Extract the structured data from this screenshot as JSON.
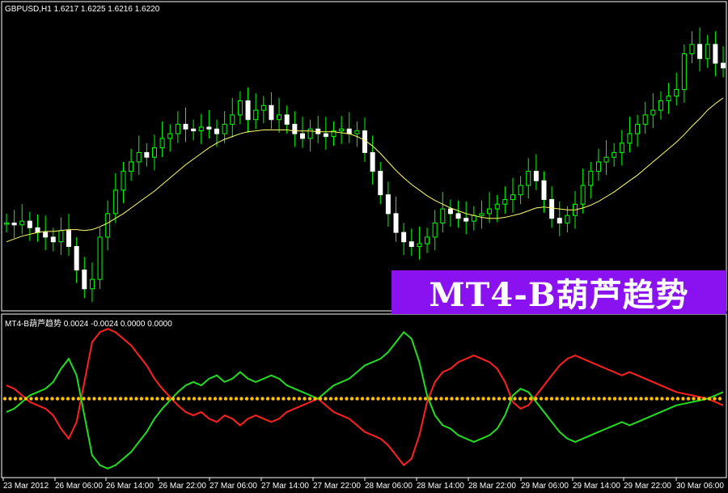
{
  "main_panel": {
    "symbol_info": "GBPUSD,H1  1.6217 1.6225 1.6216 1.6220",
    "colors": {
      "bull": "#00ff00",
      "bear": "#ffffff",
      "wick": "#00ff00",
      "ma": "#ffff66"
    }
  },
  "indicator_panel": {
    "info": "MT4-B葫芦趋势 0.0024 -0.0024 0.0000 0.0000",
    "colors": {
      "up": "#ff2020",
      "down": "#20dd20",
      "zero": "#ffc000"
    }
  },
  "watermark": {
    "text": "MT4-B葫芦趋势",
    "bg": "#8a12f0"
  },
  "time_axis": [
    "23 Mar 2012",
    "26 Mar 06:00",
    "26 Mar 14:00",
    "26 Mar 22:00",
    "27 Mar 06:00",
    "27 Mar 14:00",
    "27 Mar 22:00",
    "28 Mar 06:00",
    "28 Mar 14:00",
    "28 Mar 22:00",
    "29 Mar 06:00",
    "29 Mar 14:00",
    "29 Mar 22:00",
    "30 Mar 06:00"
  ],
  "chart_data": {
    "type": "line",
    "price_series": {
      "close": [
        1.587,
        1.5868,
        1.5872,
        1.5865,
        1.586,
        1.5855,
        1.585,
        1.5862,
        1.5845,
        1.582,
        1.58,
        1.581,
        1.5855,
        1.588,
        1.5905,
        1.5925,
        1.5935,
        1.5945,
        1.594,
        1.595,
        1.596,
        1.5965,
        1.5975,
        1.597,
        1.5968,
        1.5972,
        1.597,
        1.5965,
        1.5975,
        1.5985,
        1.6,
        1.598,
        1.599,
        1.5995,
        1.598,
        1.5985,
        1.5975,
        1.5965,
        1.596,
        1.597,
        1.5965,
        1.5962,
        1.5968,
        1.597,
        1.5965,
        1.5968,
        1.5945,
        1.5925,
        1.59,
        1.588,
        1.586,
        1.585,
        1.5845,
        1.5848,
        1.5855,
        1.587,
        1.5885,
        1.588,
        1.5875,
        1.5872,
        1.5878,
        1.588,
        1.5885,
        1.589,
        1.5895,
        1.59,
        1.591,
        1.5925,
        1.5915,
        1.5895,
        1.5875,
        1.587,
        1.5878,
        1.589,
        1.591,
        1.5925,
        1.5935,
        1.594,
        1.5945,
        1.5955,
        1.5965,
        1.5975,
        1.5985,
        1.599,
        1.6,
        1.6005,
        1.6012,
        1.605,
        1.606,
        1.6045,
        1.606,
        1.604,
        1.6035
      ],
      "ma": [
        1.585,
        1.5853,
        1.5856,
        1.5858,
        1.586,
        1.5861,
        1.5861,
        1.5862,
        1.5863,
        1.5863,
        1.5862,
        1.5863,
        1.5866,
        1.587,
        1.5875,
        1.588,
        1.5886,
        1.5892,
        1.5898,
        1.5904,
        1.5911,
        1.5918,
        1.5925,
        1.5932,
        1.5938,
        1.5944,
        1.595,
        1.5955,
        1.5959,
        1.5962,
        1.5965,
        1.5967,
        1.5968,
        1.5969,
        1.5969,
        1.5969,
        1.5969,
        1.5968,
        1.5968,
        1.5968,
        1.5967,
        1.5967,
        1.5967,
        1.5966,
        1.5965,
        1.5962,
        1.5958,
        1.5952,
        1.5944,
        1.5935,
        1.5926,
        1.5918,
        1.5911,
        1.5905,
        1.5899,
        1.5894,
        1.589,
        1.5886,
        1.5883,
        1.588,
        1.5878,
        1.5876,
        1.5875,
        1.5875,
        1.5876,
        1.5878,
        1.588,
        1.5883,
        1.5886,
        1.5887,
        1.5886,
        1.5885,
        1.5884,
        1.5884,
        1.5886,
        1.5889,
        1.5893,
        1.5898,
        1.5903,
        1.5909,
        1.5915,
        1.5921,
        1.5928,
        1.5935,
        1.5942,
        1.5949,
        1.5956,
        1.5964,
        1.5973,
        1.5981,
        1.599,
        1.5997,
        1.6003
      ]
    },
    "indicator": {
      "up": [
        0.0008,
        0.0006,
        0.0002,
        -0.0002,
        -0.0004,
        -0.0006,
        -0.001,
        -0.0018,
        -0.0024,
        -0.0014,
        0.001,
        0.0034,
        0.004,
        0.0042,
        0.004,
        0.0036,
        0.0032,
        0.0026,
        0.002,
        0.0012,
        0.0006,
        0.0001,
        -0.0004,
        -0.0008,
        -0.001,
        -0.0008,
        -0.0012,
        -0.0014,
        -0.001,
        -0.0012,
        -0.0016,
        -0.0012,
        -0.001,
        -0.0012,
        -0.0014,
        -0.0012,
        -0.0008,
        -0.0006,
        -0.0004,
        -0.0002,
        0.0,
        -0.0004,
        -0.0008,
        -0.001,
        -0.0012,
        -0.0016,
        -0.002,
        -0.0022,
        -0.0024,
        -0.0028,
        -0.0034,
        -0.004,
        -0.0036,
        -0.0022,
        -0.0002,
        0.001,
        0.0016,
        0.0018,
        0.0022,
        0.0024,
        0.0026,
        0.0024,
        0.0022,
        0.0018,
        0.001,
        -0.0002,
        -0.0006,
        -0.0004,
        0.0002,
        0.0008,
        0.0014,
        0.002,
        0.0024,
        0.0026,
        0.0024,
        0.0022,
        0.002,
        0.0018,
        0.0016,
        0.0014,
        0.0016,
        0.0014,
        0.0012,
        0.001,
        0.0008,
        0.0006,
        0.0004,
        0.0003,
        0.0002,
        0.0001,
        0.0,
        -0.0002,
        -0.0004
      ],
      "down": [
        -0.0008,
        -0.0006,
        -0.0002,
        0.0002,
        0.0004,
        0.0006,
        0.001,
        0.0018,
        0.0024,
        0.0014,
        -0.001,
        -0.0034,
        -0.004,
        -0.0042,
        -0.004,
        -0.0036,
        -0.0032,
        -0.0026,
        -0.002,
        -0.0012,
        -0.0006,
        -0.0001,
        0.0004,
        0.0008,
        0.001,
        0.0008,
        0.0012,
        0.0014,
        0.001,
        0.0012,
        0.0016,
        0.0012,
        0.001,
        0.0012,
        0.0014,
        0.0012,
        0.0008,
        0.0006,
        0.0004,
        0.0002,
        0.0,
        0.0004,
        0.0008,
        0.001,
        0.0012,
        0.0016,
        0.002,
        0.0022,
        0.0024,
        0.0028,
        0.0034,
        0.004,
        0.0036,
        0.0022,
        0.0002,
        -0.001,
        -0.0016,
        -0.0018,
        -0.0022,
        -0.0024,
        -0.0026,
        -0.0024,
        -0.0022,
        -0.0018,
        -0.001,
        0.0002,
        0.0006,
        0.0004,
        -0.0002,
        -0.0008,
        -0.0014,
        -0.002,
        -0.0024,
        -0.0026,
        -0.0024,
        -0.0022,
        -0.002,
        -0.0018,
        -0.0016,
        -0.0014,
        -0.0016,
        -0.0014,
        -0.0012,
        -0.001,
        -0.0008,
        -0.0006,
        -0.0004,
        -0.0003,
        -0.0002,
        -0.0001,
        0.0,
        0.0002,
        0.0004
      ],
      "zero_line": 0.0,
      "ylim": [
        -0.0045,
        0.0045
      ]
    },
    "price_ylim": [
      1.578,
      1.609
    ]
  }
}
